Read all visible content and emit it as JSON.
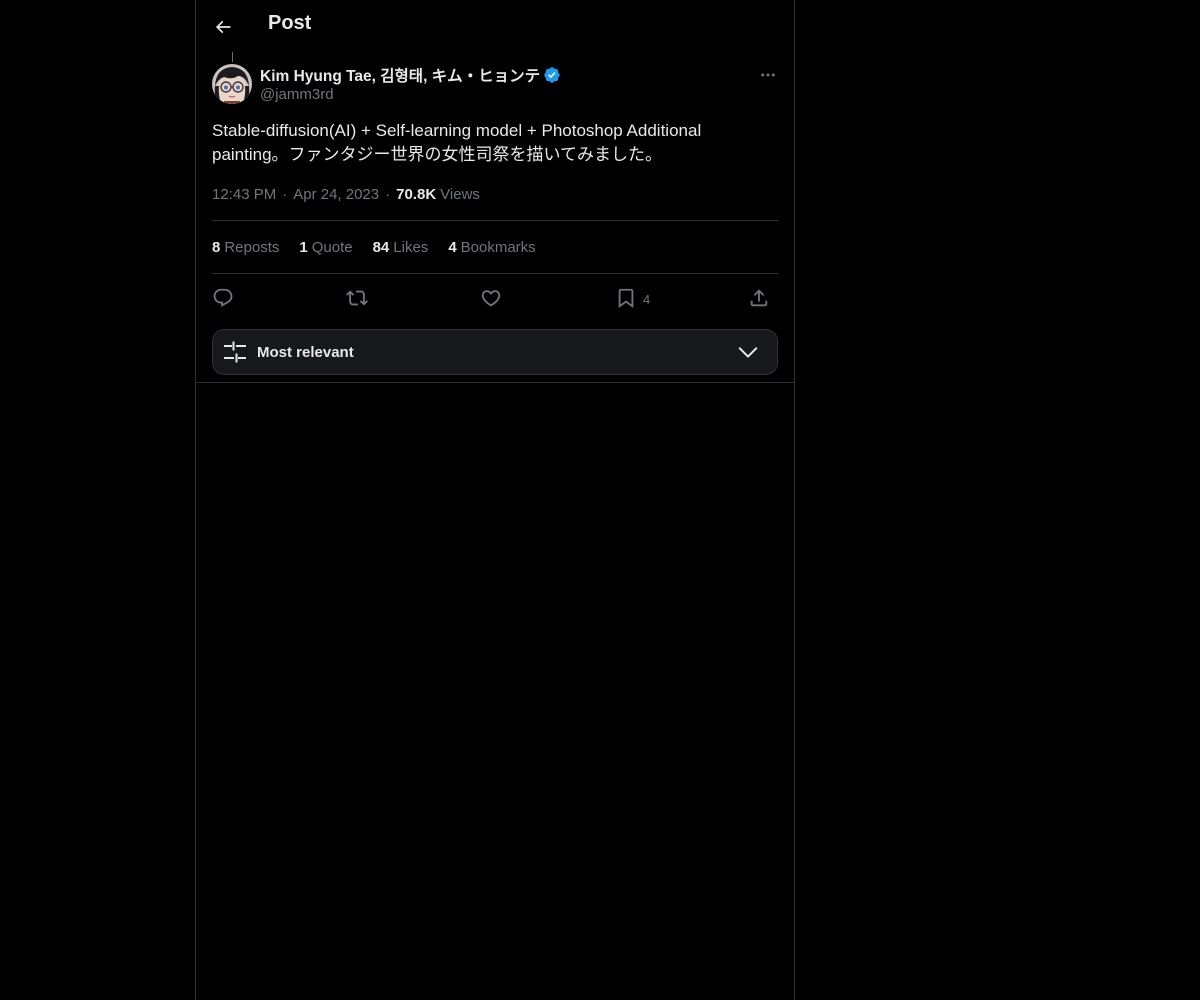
{
  "header": {
    "title": "Post",
    "back_icon": "arrow-left-icon"
  },
  "post": {
    "author": {
      "display_name": "Kim Hyung Tae, 김형태, キム・ヒョンテ",
      "handle": "@jamm3rd",
      "verified": true,
      "verified_color": "#1d9bf0"
    },
    "text": "Stable-diffusion(AI) + Self-learning model + Photoshop Additional painting。ファンタジー世界の女性司祭を描いてみました。",
    "time": "12:43 PM",
    "separator": "·",
    "date": "Apr 24, 2023",
    "views_count": "70.8K",
    "views_label": "Views"
  },
  "stats": [
    {
      "count": "8",
      "label": "Reposts"
    },
    {
      "count": "1",
      "label": "Quote"
    },
    {
      "count": "84",
      "label": "Likes"
    },
    {
      "count": "4",
      "label": "Bookmarks"
    }
  ],
  "actions": {
    "reply_icon": "reply-icon",
    "repost_icon": "repost-icon",
    "like_icon": "heart-icon",
    "bookmark_icon": "bookmark-icon",
    "bookmark_count": "4",
    "share_icon": "share-icon"
  },
  "sort": {
    "label": "Most relevant",
    "icon": "sliders-icon",
    "chevron": "chevron-down-icon"
  },
  "colors": {
    "background": "#000000",
    "text_primary": "#e7e9ea",
    "text_secondary": "#71767b",
    "border": "#2f3336",
    "accent": "#1d9bf0"
  }
}
